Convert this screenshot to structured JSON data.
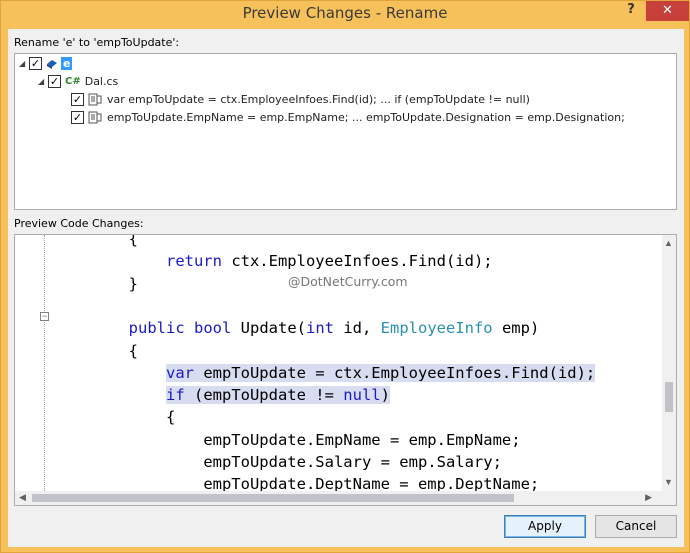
{
  "window": {
    "title": "Preview Changes - Rename",
    "help": "?",
    "close": "✕"
  },
  "rename_label": "Rename 'e' to 'empToUpdate':",
  "tree": {
    "root": {
      "label": "e",
      "checked": true
    },
    "file": {
      "label": "Dal.cs",
      "checked": true
    },
    "items": [
      {
        "label": "var empToUpdate = ctx.EmployeeInfoes.Find(id); ... if (empToUpdate != null)",
        "checked": true
      },
      {
        "label": "empToUpdate.EmpName = emp.EmpName; ... empToUpdate.Designation = emp.Designation;",
        "checked": true
      }
    ]
  },
  "preview_label": "Preview Code Changes:",
  "watermark": "@DotNetCurry.com",
  "code_lines": [
    {
      "indent": "        ",
      "parts": [
        {
          "t": "{",
          "c": "pl"
        }
      ]
    },
    {
      "indent": "            ",
      "parts": [
        {
          "t": "return",
          "c": "kw"
        },
        {
          "t": " ctx.EmployeeInfoes.Find(id);",
          "c": "pl"
        }
      ]
    },
    {
      "indent": "        ",
      "parts": [
        {
          "t": "}",
          "c": "pl"
        }
      ]
    },
    {
      "indent": "",
      "parts": []
    },
    {
      "indent": "        ",
      "parts": [
        {
          "t": "public",
          "c": "kw"
        },
        {
          "t": " ",
          "c": "pl"
        },
        {
          "t": "bool",
          "c": "kw"
        },
        {
          "t": " Update(",
          "c": "pl"
        },
        {
          "t": "int",
          "c": "kw"
        },
        {
          "t": " id, ",
          "c": "pl"
        },
        {
          "t": "EmployeeInfo",
          "c": "ty"
        },
        {
          "t": " emp)",
          "c": "pl"
        }
      ]
    },
    {
      "indent": "        ",
      "parts": [
        {
          "t": "{",
          "c": "pl"
        }
      ]
    },
    {
      "indent": "            ",
      "highlight": true,
      "parts": [
        {
          "t": "var",
          "c": "kw"
        },
        {
          "t": " empToUpdate = ctx.EmployeeInfoes.Find(id);",
          "c": "pl"
        }
      ]
    },
    {
      "indent": "            ",
      "highlight": true,
      "parts": [
        {
          "t": "if",
          "c": "kw"
        },
        {
          "t": " (empToUpdate != ",
          "c": "pl"
        },
        {
          "t": "null",
          "c": "kw"
        },
        {
          "t": ")",
          "c": "pl"
        }
      ]
    },
    {
      "indent": "            ",
      "parts": [
        {
          "t": "{",
          "c": "pl"
        }
      ]
    },
    {
      "indent": "                ",
      "parts": [
        {
          "t": "empToUpdate.EmpName = emp.EmpName;",
          "c": "pl"
        }
      ]
    },
    {
      "indent": "                ",
      "parts": [
        {
          "t": "empToUpdate.Salary = emp.Salary;",
          "c": "pl"
        }
      ]
    },
    {
      "indent": "                ",
      "parts": [
        {
          "t": "empToUpdate.DeptName = emp.DeptName;",
          "c": "pl"
        }
      ]
    }
  ],
  "buttons": {
    "apply": "Apply",
    "cancel": "Cancel"
  }
}
